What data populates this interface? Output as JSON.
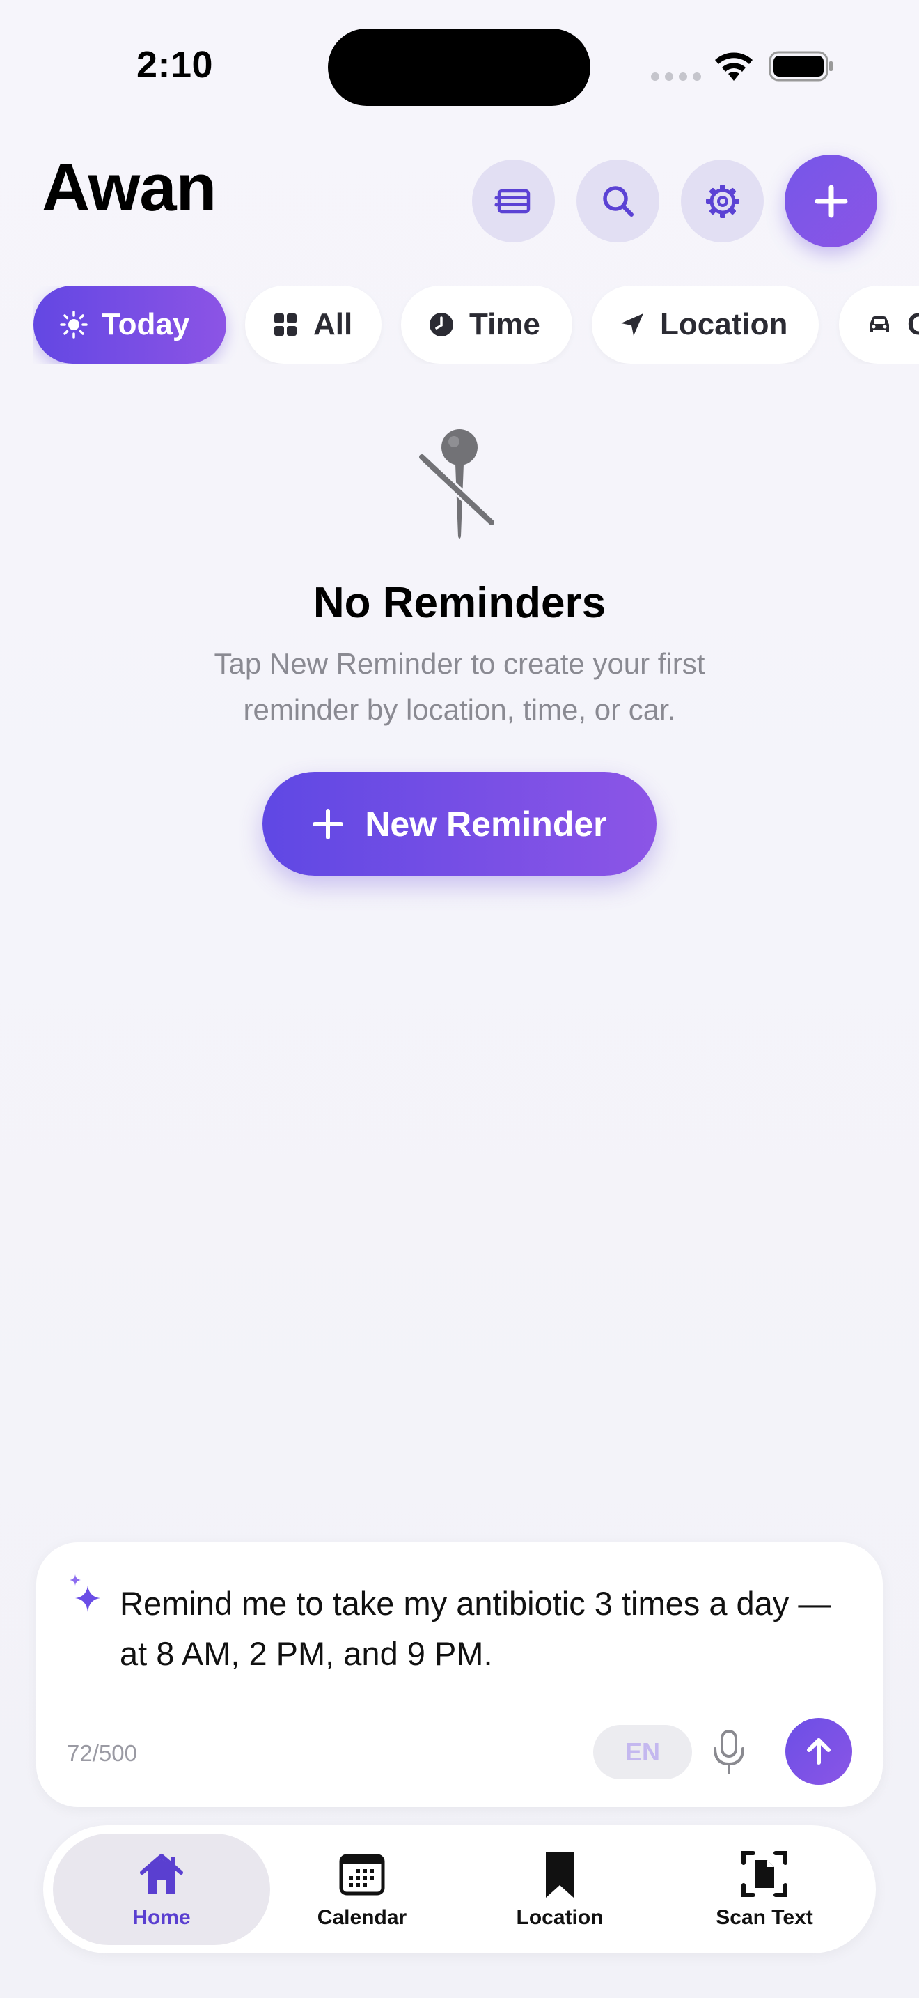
{
  "status_bar": {
    "time": "2:10"
  },
  "header": {
    "title": "Awan"
  },
  "icons": {
    "list": "list-icon",
    "search": "search-icon",
    "settings": "gear-icon",
    "add": "plus-icon"
  },
  "filters": [
    {
      "label": "Today",
      "icon": "sun-icon",
      "active": true
    },
    {
      "label": "All",
      "icon": "grid-icon",
      "active": false
    },
    {
      "label": "Time",
      "icon": "clock-icon",
      "active": false
    },
    {
      "label": "Location",
      "icon": "location-arrow-icon",
      "active": false
    },
    {
      "label": "Car",
      "icon": "car-icon",
      "active": false
    }
  ],
  "empty_state": {
    "title": "No Reminders",
    "subtitle": "Tap New Reminder to create your first reminder by location, time, or car.",
    "button_label": "New Reminder"
  },
  "composer": {
    "text": "Remind me to take my antibiotic 3 times a day — at 8 AM, 2 PM, and 9 PM.",
    "counter": "72/500",
    "language": "EN"
  },
  "tabs": [
    {
      "label": "Home",
      "active": true
    },
    {
      "label": "Calendar",
      "active": false
    },
    {
      "label": "Location",
      "active": false
    },
    {
      "label": "Scan Text",
      "active": false
    }
  ],
  "colors": {
    "accent": "#6a4de6",
    "accent_end": "#8c55e6",
    "background": "#f3f3f9"
  }
}
